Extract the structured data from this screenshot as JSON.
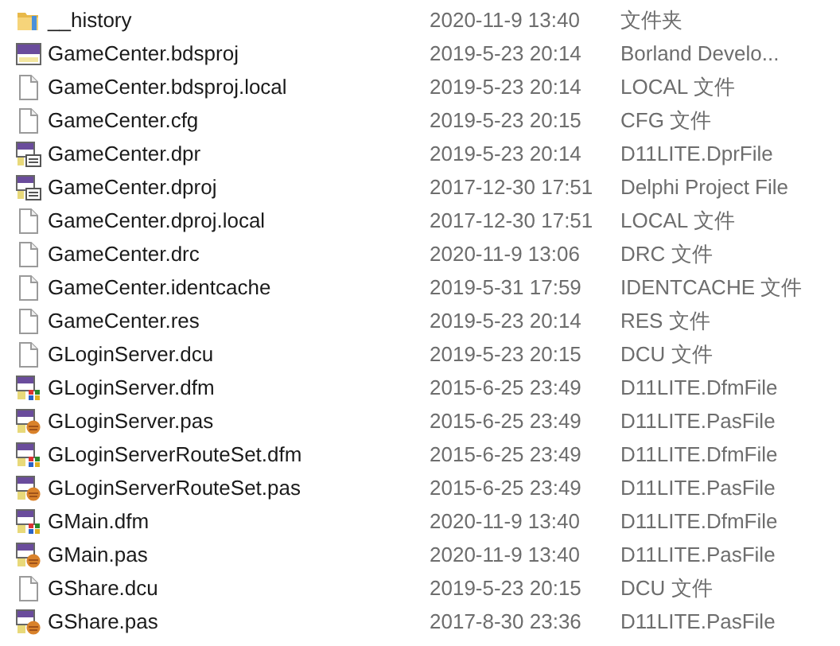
{
  "files": [
    {
      "name": "__history",
      "modified": "2020-11-9 13:40",
      "type": "文件夹",
      "kind": "folder"
    },
    {
      "name": "GameCenter.bdsproj",
      "modified": "2019-5-23 20:14",
      "type": "Borland Develo...",
      "kind": "bds"
    },
    {
      "name": "GameCenter.bdsproj.local",
      "modified": "2019-5-23 20:14",
      "type": "LOCAL 文件",
      "kind": "blank"
    },
    {
      "name": "GameCenter.cfg",
      "modified": "2019-5-23 20:15",
      "type": "CFG 文件",
      "kind": "blank"
    },
    {
      "name": "GameCenter.dpr",
      "modified": "2019-5-23 20:14",
      "type": "D11LITE.DprFile",
      "kind": "dpr"
    },
    {
      "name": "GameCenter.dproj",
      "modified": "2017-12-30 17:51",
      "type": "Delphi Project File",
      "kind": "dpr"
    },
    {
      "name": "GameCenter.dproj.local",
      "modified": "2017-12-30 17:51",
      "type": "LOCAL 文件",
      "kind": "blank"
    },
    {
      "name": "GameCenter.drc",
      "modified": "2020-11-9 13:06",
      "type": "DRC 文件",
      "kind": "blank"
    },
    {
      "name": "GameCenter.identcache",
      "modified": "2019-5-31 17:59",
      "type": "IDENTCACHE 文件",
      "kind": "blank"
    },
    {
      "name": "GameCenter.res",
      "modified": "2019-5-23 20:14",
      "type": "RES 文件",
      "kind": "blank"
    },
    {
      "name": "GLoginServer.dcu",
      "modified": "2019-5-23 20:15",
      "type": "DCU 文件",
      "kind": "blank"
    },
    {
      "name": "GLoginServer.dfm",
      "modified": "2015-6-25 23:49",
      "type": "D11LITE.DfmFile",
      "kind": "dfm"
    },
    {
      "name": "GLoginServer.pas",
      "modified": "2015-6-25 23:49",
      "type": "D11LITE.PasFile",
      "kind": "pas"
    },
    {
      "name": "GLoginServerRouteSet.dfm",
      "modified": "2015-6-25 23:49",
      "type": "D11LITE.DfmFile",
      "kind": "dfm"
    },
    {
      "name": "GLoginServerRouteSet.pas",
      "modified": "2015-6-25 23:49",
      "type": "D11LITE.PasFile",
      "kind": "pas"
    },
    {
      "name": "GMain.dfm",
      "modified": "2020-11-9 13:40",
      "type": "D11LITE.DfmFile",
      "kind": "dfm"
    },
    {
      "name": "GMain.pas",
      "modified": "2020-11-9 13:40",
      "type": "D11LITE.PasFile",
      "kind": "pas"
    },
    {
      "name": "GShare.dcu",
      "modified": "2019-5-23 20:15",
      "type": "DCU 文件",
      "kind": "blank"
    },
    {
      "name": "GShare.pas",
      "modified": "2017-8-30 23:36",
      "type": "D11LITE.PasFile",
      "kind": "pas"
    }
  ]
}
